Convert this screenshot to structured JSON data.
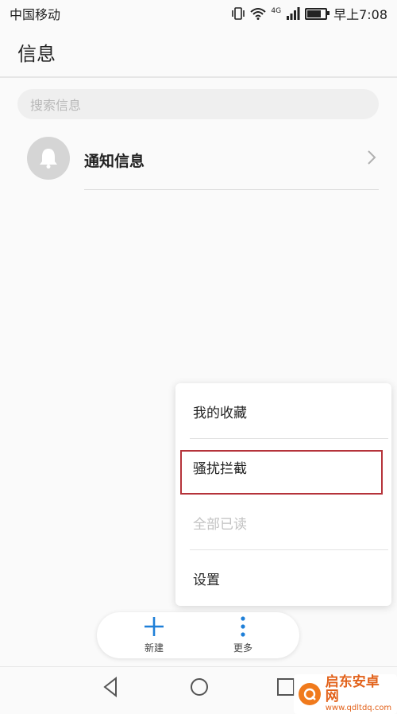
{
  "status_bar": {
    "carrier": "中国移动",
    "network": "4G",
    "time": "早上7:08"
  },
  "header": {
    "title": "信息"
  },
  "search": {
    "placeholder": "搜索信息"
  },
  "conversations": [
    {
      "title": "通知信息",
      "avatar_icon": "bell-icon"
    }
  ],
  "popup_menu": {
    "items": [
      {
        "label": "我的收藏",
        "enabled": true
      },
      {
        "label": "骚扰拦截",
        "enabled": true,
        "highlighted": true
      },
      {
        "label": "全部已读",
        "enabled": false
      },
      {
        "label": "设置",
        "enabled": true
      }
    ],
    "highlight_color": "#b5333a"
  },
  "bottom_actions": {
    "new_label": "新建",
    "more_label": "更多",
    "accent": "#1e7fd8"
  },
  "watermark": {
    "brand": "启东安卓网",
    "url": "www.qdltdq.com"
  }
}
